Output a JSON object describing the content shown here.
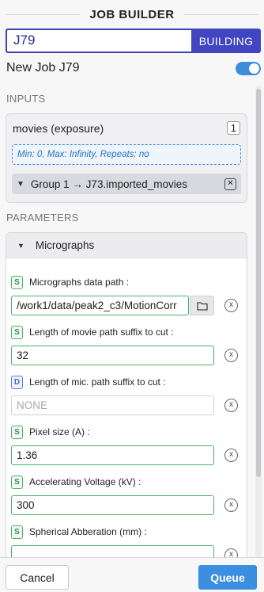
{
  "header": {
    "title": "JOB BUILDER"
  },
  "job": {
    "id": "J79",
    "status": "BUILDING",
    "name": "New Job J79",
    "enabled": true
  },
  "inputs": {
    "label": "INPUTS",
    "slot": {
      "name": "movies (exposure)",
      "count": "1",
      "constraints": "Min: 0, Max: Infinity, Repeats: no",
      "group": {
        "label": "Group 1 → J73.imported_movies"
      }
    }
  },
  "parameters": {
    "label": "PARAMETERS",
    "group_title": "Micrographs",
    "fields": [
      {
        "badge": "S",
        "label": "Micrographs data path :",
        "value": "/work1/data/peak2_c3/MotionCorr",
        "placeholder": ""
      },
      {
        "badge": "S",
        "label": "Length of movie path suffix to cut :",
        "value": "32",
        "placeholder": ""
      },
      {
        "badge": "D",
        "label": "Length of mic. path suffix to cut :",
        "value": "",
        "placeholder": "NONE"
      },
      {
        "badge": "S",
        "label": "Pixel size (A) :",
        "value": "1.36",
        "placeholder": ""
      },
      {
        "badge": "S",
        "label": "Accelerating Voltage (kV) :",
        "value": "300",
        "placeholder": ""
      },
      {
        "badge": "S",
        "label": "Spherical Abberation (mm) :",
        "value": "",
        "placeholder": ""
      }
    ],
    "clear_glyph": "x"
  },
  "footer": {
    "cancel_label": "Cancel",
    "queue_label": "Queue"
  },
  "colors": {
    "accent": "#4145c1",
    "primary": "#3c8fe0",
    "set_badge": "#4caf6d",
    "default_badge": "#5b7fd9"
  }
}
